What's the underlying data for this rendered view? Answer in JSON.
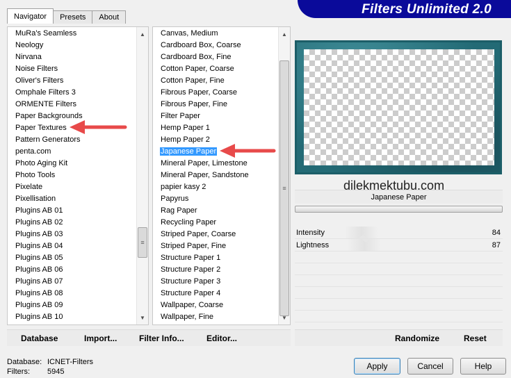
{
  "tabs": [
    {
      "label": "Navigator",
      "active": true
    },
    {
      "label": "Presets",
      "active": false
    },
    {
      "label": "About",
      "active": false
    }
  ],
  "app_title": "Filters Unlimited 2.0",
  "categories": [
    "MuRa's Seamless",
    "Neology",
    "Nirvana",
    "Noise Filters",
    "Oliver's Filters",
    "Omphale Filters 3",
    "ORMENTE Filters",
    "Paper Backgrounds",
    "Paper Textures",
    "Pattern Generators",
    "penta.com",
    "Photo Aging Kit",
    "Photo Tools",
    "Pixelate",
    "Pixellisation",
    "Plugins AB 01",
    "Plugins AB 02",
    "Plugins AB 03",
    "Plugins AB 04",
    "Plugins AB 05",
    "Plugins AB 06",
    "Plugins AB 07",
    "Plugins AB 08",
    "Plugins AB 09",
    "Plugins AB 10"
  ],
  "filters": [
    "Canvas, Medium",
    "Cardboard Box, Coarse",
    "Cardboard Box, Fine",
    "Cotton Paper, Coarse",
    "Cotton Paper, Fine",
    "Fibrous Paper, Coarse",
    "Fibrous Paper, Fine",
    "Filter Paper",
    "Hemp Paper 1",
    "Hemp Paper 2",
    "Japanese Paper",
    "Mineral Paper, Limestone",
    "Mineral Paper, Sandstone",
    "papier kasy 2",
    "Papyrus",
    "Rag Paper",
    "Recycling Paper",
    "Striped Paper, Coarse",
    "Striped Paper, Fine",
    "Structure Paper 1",
    "Structure Paper 2",
    "Structure Paper 3",
    "Structure Paper 4",
    "Wallpaper, Coarse",
    "Wallpaper, Fine"
  ],
  "selected_filter_index": 10,
  "watermark": "dilekmektubu.com",
  "current_filter": "Japanese Paper",
  "params": [
    {
      "name": "Intensity",
      "value": "84"
    },
    {
      "name": "Lightness",
      "value": "87"
    }
  ],
  "toolbar": {
    "database": "Database",
    "import": "Import...",
    "filter_info": "Filter Info...",
    "editor": "Editor...",
    "randomize": "Randomize",
    "reset": "Reset"
  },
  "status": {
    "database_label": "Database:",
    "database_value": "ICNET-Filters",
    "filters_label": "Filters:",
    "filters_value": "5945"
  },
  "buttons": {
    "apply": "Apply",
    "cancel": "Cancel",
    "help": "Help"
  },
  "colors": {
    "banner": "#0a0a9a",
    "selection": "#3399ff",
    "arrow": "#e84a4a",
    "preview_border": "#1c5e68"
  }
}
